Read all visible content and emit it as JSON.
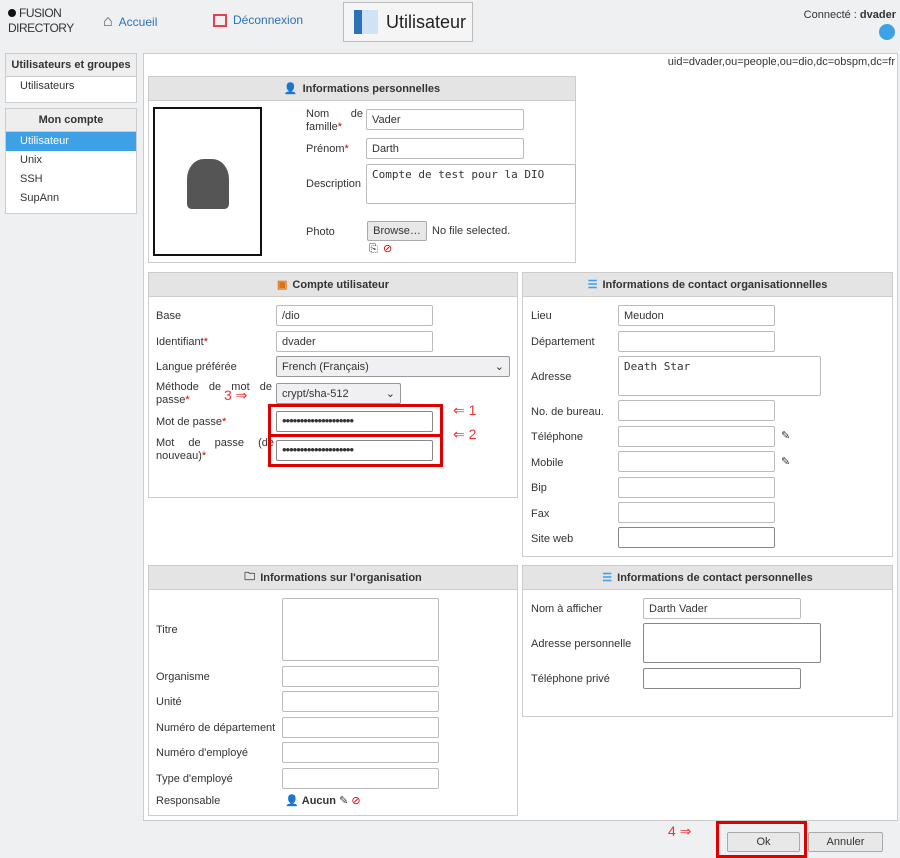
{
  "header": {
    "logo": "FUSION DIRECTORY",
    "home": "Accueil",
    "logout": "Déconnexion",
    "page_title": "Utilisateur",
    "connected_label": "Connecté :",
    "connected_user": "dvader"
  },
  "sidebar": {
    "groups": [
      {
        "title": "Utilisateurs et groupes",
        "items": [
          "Utilisateurs"
        ]
      },
      {
        "title": "Mon compte",
        "items": [
          "Utilisateur",
          "Unix",
          "SSH",
          "SupAnn"
        ],
        "selected": "Utilisateur"
      }
    ]
  },
  "dn": "uid=dvader,ou=people,ou=dio,dc=obspm,dc=fr",
  "personal": {
    "title": "Informations personnelles",
    "nom_label": "Nom de famille",
    "nom": "Vader",
    "prenom_label": "Prénom",
    "prenom": "Darth",
    "desc_label": "Description",
    "desc": "Compte de test pour la DIO",
    "photo_label": "Photo",
    "browse": "Browse…",
    "no_file": "No file selected."
  },
  "account": {
    "title": "Compte utilisateur",
    "base_label": "Base",
    "base": "/dio",
    "id_label": "Identifiant",
    "id": "dvader",
    "lang_label": "Langue préférée",
    "lang": "French (Français)",
    "method_label": "Méthode de mot de passe",
    "method": "crypt/sha-512",
    "pw_label": "Mot de passe",
    "pw": "••••••••••••••••••••",
    "pw2_label": "Mot de passe (de nouveau)",
    "pw2": "••••••••••••••••••••"
  },
  "org_contact": {
    "title": "Informations de contact organisationnelles",
    "fields": [
      {
        "label": "Lieu",
        "value": "Meudon"
      },
      {
        "label": "Département",
        "value": ""
      },
      {
        "label": "Adresse",
        "value": "Death Star"
      },
      {
        "label": "No. de bureau.",
        "value": ""
      },
      {
        "label": "Téléphone",
        "value": ""
      },
      {
        "label": "Mobile",
        "value": ""
      },
      {
        "label": "Bip",
        "value": ""
      },
      {
        "label": "Fax",
        "value": ""
      },
      {
        "label": "Site web",
        "value": ""
      }
    ]
  },
  "org": {
    "title": "Informations sur l'organisation",
    "fields": [
      {
        "label": "Titre",
        "value": ""
      },
      {
        "label": "Organisme",
        "value": ""
      },
      {
        "label": "Unité",
        "value": ""
      },
      {
        "label": "Numéro de département",
        "value": ""
      },
      {
        "label": "Numéro d'employé",
        "value": ""
      },
      {
        "label": "Type d'employé",
        "value": ""
      }
    ],
    "manager_label": "Responsable",
    "manager": "Aucun"
  },
  "personal_contact": {
    "title": "Informations de contact personnelles",
    "fields": [
      {
        "label": "Nom à afficher",
        "value": "Darth Vader"
      },
      {
        "label": "Adresse personnelle",
        "value": ""
      },
      {
        "label": "Téléphone privé",
        "value": ""
      }
    ]
  },
  "annotations": [
    "1",
    "2",
    "3",
    "4"
  ],
  "buttons": {
    "ok": "Ok",
    "cancel": "Annuler"
  },
  "colors": {
    "accent": "#3ea1e5",
    "highlight": "#d00000",
    "link": "#2d72b8"
  }
}
